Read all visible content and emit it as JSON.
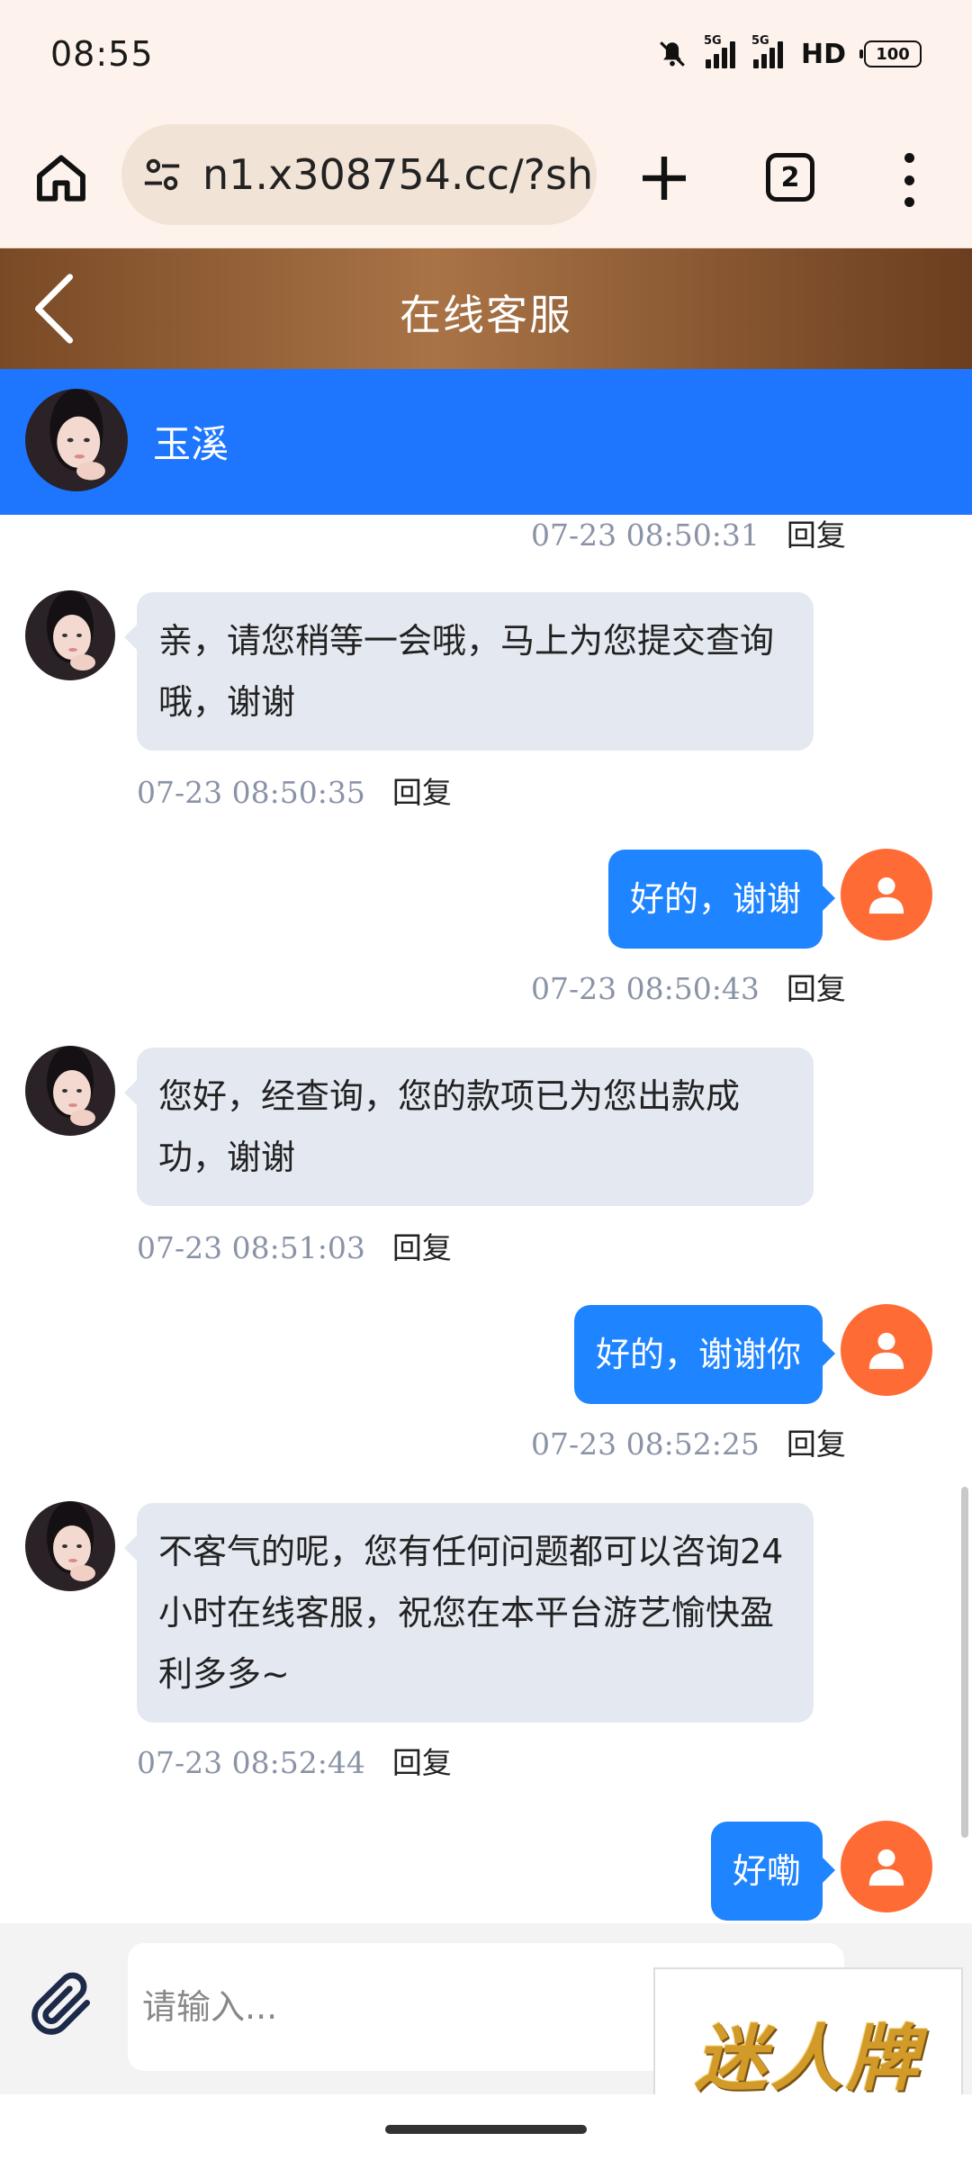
{
  "status_bar": {
    "time": "08:55",
    "sim1": "5G",
    "sim2": "5G",
    "hd": "HD",
    "battery": "100"
  },
  "browser": {
    "url": "n1.x308754.cc/?sh",
    "tab_count": "2"
  },
  "header": {
    "title": "在线客服"
  },
  "agent": {
    "name": "玉溪"
  },
  "chat": {
    "reply_label": "回复",
    "top_meta": "07-23 08:50:31",
    "messages": [
      {
        "from": "agent",
        "text": "亲，请您稍等一会哦，马上为您提交查询哦，谢谢",
        "time": "07-23 08:50:35"
      },
      {
        "from": "user",
        "text": "好的，谢谢",
        "time": "07-23 08:50:43"
      },
      {
        "from": "agent",
        "text": "您好，经查询，您的款项已为您出款成功，谢谢",
        "time": "07-23 08:51:03"
      },
      {
        "from": "user",
        "text": "好的，谢谢你",
        "time": "07-23 08:52:25"
      },
      {
        "from": "agent",
        "text": "不客气的呢，您有任何问题都可以咨询24小时在线客服，祝您在本平台游艺愉快盈利多多~",
        "time": "07-23 08:52:44"
      },
      {
        "from": "user",
        "text": "好嘞",
        "time": ""
      }
    ]
  },
  "input": {
    "placeholder": "请输入..."
  },
  "brand": {
    "text": "迷人牌"
  },
  "colors": {
    "header_brown": "#8b5a2b",
    "agent_blue": "#1e76ff",
    "user_bubble": "#1e84ff",
    "user_avatar": "#ff6b35",
    "agent_bubble": "#e4e9f1"
  }
}
